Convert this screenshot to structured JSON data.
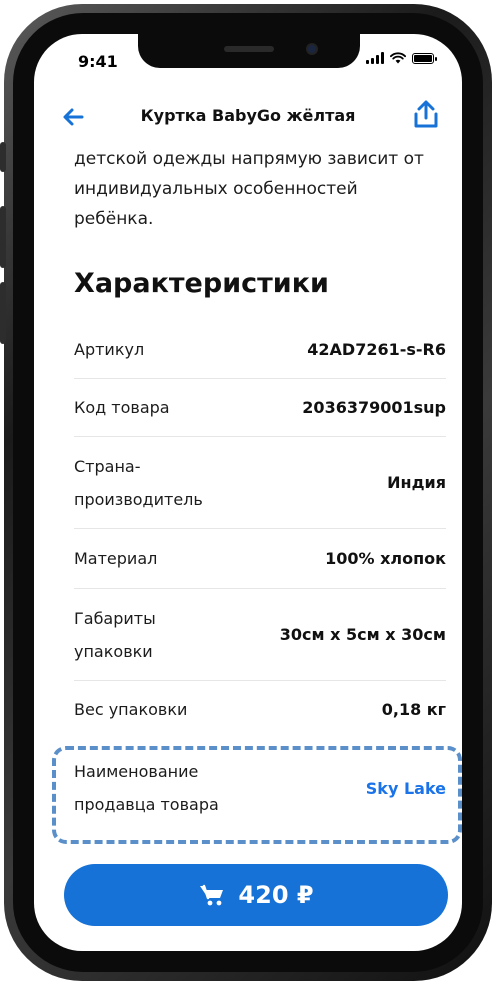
{
  "status_bar": {
    "time": "9:41"
  },
  "header": {
    "title": "Куртка BabyGo жёлтая"
  },
  "description": {
    "lines": [
      "детской одежды напрямую зависит от",
      "индивидуальных особенностей",
      "ребёнка."
    ]
  },
  "specs": {
    "title": "Характеристики",
    "rows": [
      {
        "label": [
          "Артикул"
        ],
        "value": "42AD7261-s-R6"
      },
      {
        "label": [
          "Код товара"
        ],
        "value": "2036379001sup"
      },
      {
        "label": [
          "Страна-",
          "производитель"
        ],
        "value": "Индия"
      },
      {
        "label": [
          "Материал"
        ],
        "value": "100% хлопок"
      },
      {
        "label": [
          "Габариты",
          "упаковки"
        ],
        "value": "30см х 5см х 30см"
      },
      {
        "label": [
          "Вес упаковки"
        ],
        "value": "0,18 кг"
      },
      {
        "label": [
          "Наименование",
          "продавца товара"
        ],
        "value": "Sky Lake"
      }
    ]
  },
  "cart": {
    "price": "420 ₽"
  },
  "colors": {
    "accent": "#1672d6",
    "link": "#1a73e8",
    "highlight": "#5b8fc9"
  }
}
